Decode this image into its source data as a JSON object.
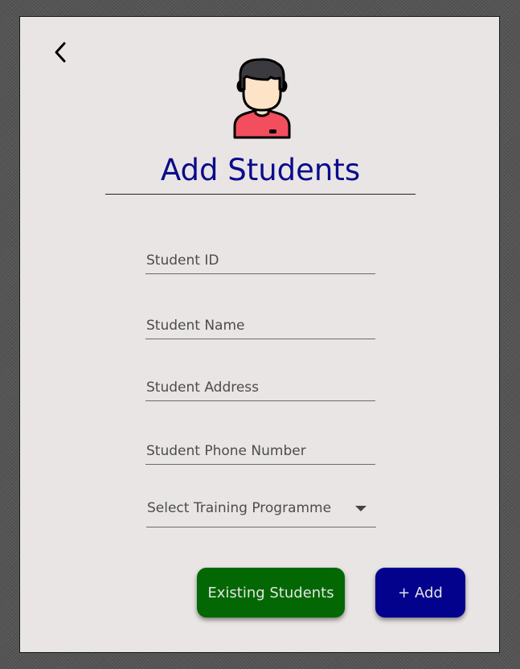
{
  "page": {
    "title": "Add Students"
  },
  "icons": {
    "back": "chevron-left-icon",
    "avatar": "student-avatar-icon"
  },
  "form": {
    "student_id_placeholder": "Student ID",
    "student_name_placeholder": "Student Name",
    "student_address_placeholder": "Student Address",
    "student_phone_placeholder": "Student Phone Number",
    "programme_select_label": "Select Training Programme"
  },
  "buttons": {
    "existing_students_label": "Existing Students",
    "add_label": "+ Add"
  },
  "colors": {
    "title": "#0b0b8c",
    "existing_button": "#036803",
    "add_button": "#02028d",
    "avatar_shirt": "#f24e5e",
    "avatar_skin": "#fde3c8"
  }
}
